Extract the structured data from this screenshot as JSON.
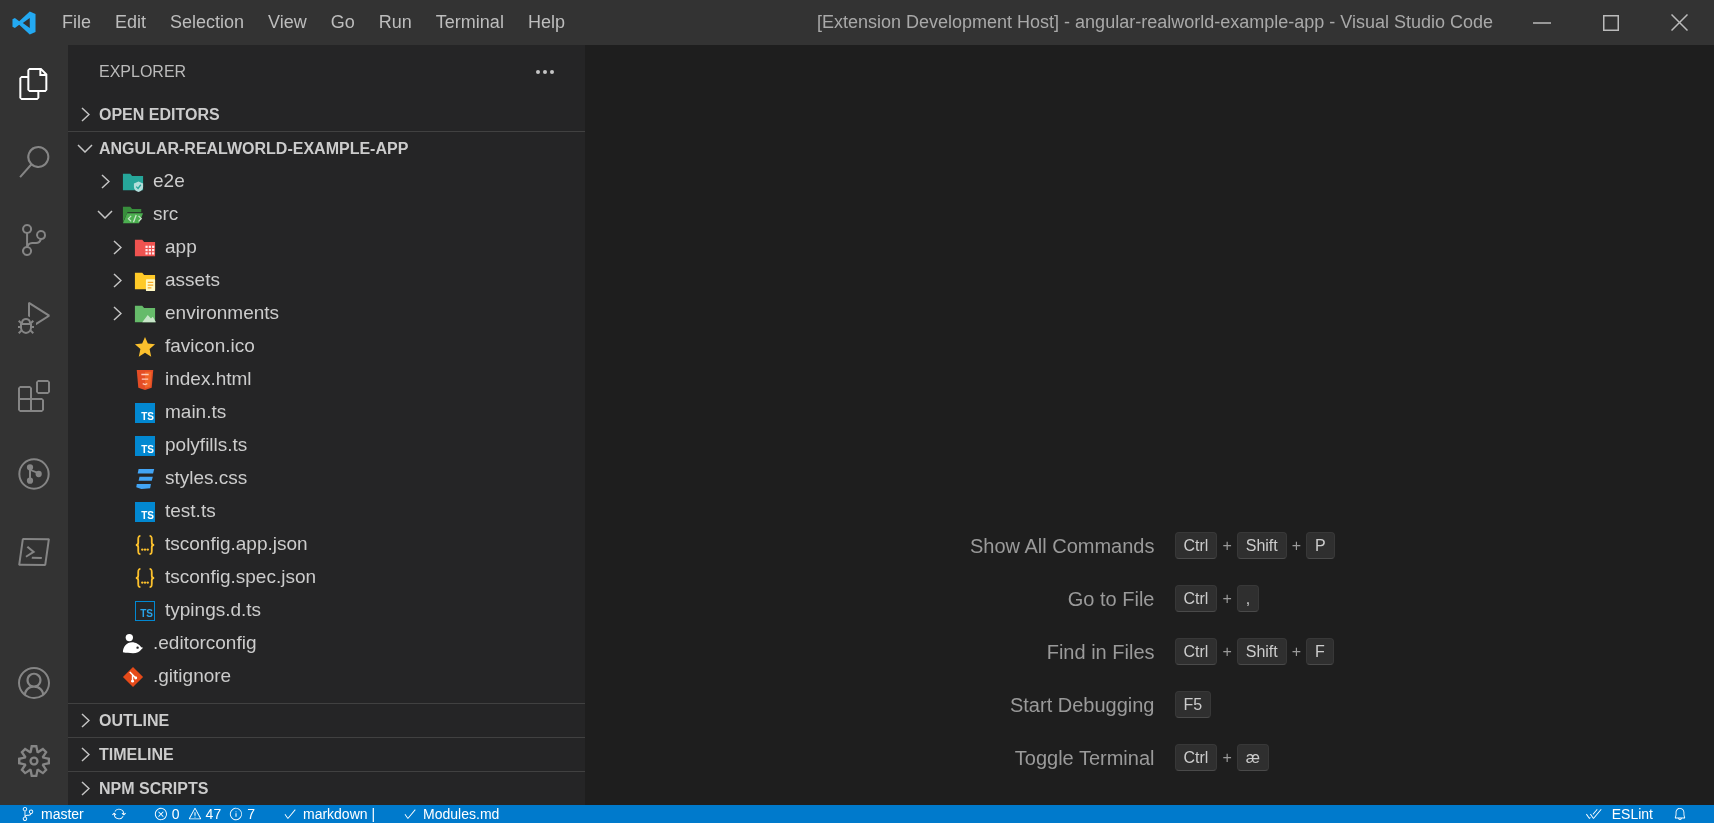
{
  "title_bar": {
    "menu": [
      "File",
      "Edit",
      "Selection",
      "View",
      "Go",
      "Run",
      "Terminal",
      "Help"
    ],
    "title": "[Extension Development Host] - angular-realworld-example-app - Visual Studio Code"
  },
  "activity_bar": {
    "top": [
      {
        "kind": "explorer",
        "selected": true
      },
      {
        "kind": "search",
        "selected": false
      },
      {
        "kind": "source-control",
        "selected": false
      },
      {
        "kind": "run-debug",
        "selected": false
      },
      {
        "kind": "extensions",
        "selected": false
      },
      {
        "kind": "git-graph",
        "selected": false
      },
      {
        "kind": "powershell",
        "selected": false
      }
    ],
    "bottom": [
      {
        "kind": "account",
        "selected": false
      },
      {
        "kind": "settings",
        "selected": false
      }
    ]
  },
  "sidebar": {
    "title": "EXPLORER",
    "sections": [
      {
        "label": "OPEN EDITORS",
        "expanded": false
      },
      {
        "label": "ANGULAR-REALWORLD-EXAMPLE-APP",
        "expanded": true,
        "tree": [
          {
            "name": "e2e",
            "kind": "test-folder",
            "expanded": false
          },
          {
            "name": "src",
            "kind": "source-folder",
            "expanded": true,
            "children": [
              {
                "name": "app",
                "kind": "app-folder",
                "expanded": false
              },
              {
                "name": "assets",
                "kind": "assets-folder",
                "expanded": false
              },
              {
                "name": "environments",
                "kind": "env-folder",
                "expanded": false
              },
              {
                "name": "favicon.ico",
                "kind": "favicon"
              },
              {
                "name": "index.html",
                "kind": "html"
              },
              {
                "name": "main.ts",
                "kind": "ts",
                "badge": "TS"
              },
              {
                "name": "polyfills.ts",
                "kind": "ts",
                "badge": "TS"
              },
              {
                "name": "styles.css",
                "kind": "css"
              },
              {
                "name": "test.ts",
                "kind": "ts",
                "badge": "TS"
              },
              {
                "name": "tsconfig.app.json",
                "kind": "json"
              },
              {
                "name": "tsconfig.spec.json",
                "kind": "json"
              },
              {
                "name": "typings.d.ts",
                "kind": "dts",
                "badge": "TS"
              }
            ]
          },
          {
            "name": ".editorconfig",
            "kind": "editorconfig"
          },
          {
            "name": ".gitignore",
            "kind": "gitignore"
          }
        ]
      },
      {
        "label": "OUTLINE",
        "expanded": false
      },
      {
        "label": "TIMELINE",
        "expanded": false
      },
      {
        "label": "NPM SCRIPTS",
        "expanded": false
      }
    ]
  },
  "editor": {
    "shortcuts": [
      {
        "label": "Show All Commands",
        "keys": [
          {
            "kind": "key",
            "text": "Ctrl"
          },
          {
            "kind": "plus",
            "text": "+"
          },
          {
            "kind": "key",
            "text": "Shift"
          },
          {
            "kind": "plus",
            "text": "+"
          },
          {
            "kind": "key",
            "text": "P"
          }
        ]
      },
      {
        "label": "Go to File",
        "keys": [
          {
            "kind": "key",
            "text": "Ctrl"
          },
          {
            "kind": "plus",
            "text": "+"
          },
          {
            "kind": "key",
            "text": ","
          }
        ]
      },
      {
        "label": "Find in Files",
        "keys": [
          {
            "kind": "key",
            "text": "Ctrl"
          },
          {
            "kind": "plus",
            "text": "+"
          },
          {
            "kind": "key",
            "text": "Shift"
          },
          {
            "kind": "plus",
            "text": "+"
          },
          {
            "kind": "key",
            "text": "F"
          }
        ]
      },
      {
        "label": "Start Debugging",
        "keys": [
          {
            "kind": "key",
            "text": "F5"
          }
        ]
      },
      {
        "label": "Toggle Terminal",
        "keys": [
          {
            "kind": "key",
            "text": "Ctrl"
          },
          {
            "kind": "plus",
            "text": "+"
          },
          {
            "kind": "key",
            "text": "æ"
          }
        ]
      }
    ]
  },
  "status_bar": {
    "left": [
      {
        "kind": "branch",
        "text": "master"
      },
      {
        "kind": "sync"
      },
      {
        "kind": "problems",
        "errors": "0",
        "warnings": "47",
        "infos": "7"
      },
      {
        "kind": "check",
        "text": "markdown |"
      },
      {
        "kind": "check",
        "text": "Modules.md"
      }
    ],
    "right": [
      {
        "kind": "check-all",
        "text": "ESLint"
      },
      {
        "kind": "bell"
      }
    ]
  }
}
